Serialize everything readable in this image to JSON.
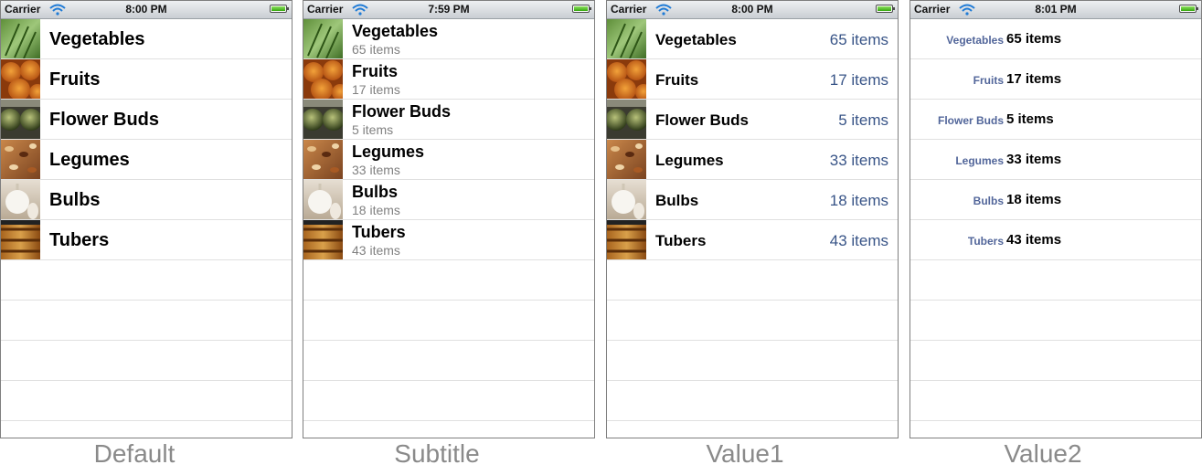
{
  "status_bar": {
    "carrier": "Carrier"
  },
  "screens": [
    {
      "caption": "Default",
      "time": "8:00 PM"
    },
    {
      "caption": "Subtitle",
      "time": "7:59 PM"
    },
    {
      "caption": "Value1",
      "time": "8:00 PM"
    },
    {
      "caption": "Value2",
      "time": "8:01 PM"
    }
  ],
  "items": [
    {
      "title": "Vegetables",
      "detail": "65 items",
      "thumb": "vegetables-photo"
    },
    {
      "title": "Fruits",
      "detail": "17 items",
      "thumb": "fruits-photo"
    },
    {
      "title": "Flower Buds",
      "detail": "5 items",
      "thumb": "flower-buds-photo"
    },
    {
      "title": "Legumes",
      "detail": "33 items",
      "thumb": "legumes-photo"
    },
    {
      "title": "Bulbs",
      "detail": "18 items",
      "thumb": "bulbs-photo"
    },
    {
      "title": "Tubers",
      "detail": "43 items",
      "thumb": "tubers-photo"
    }
  ],
  "colors": {
    "detail_blue": "#385487",
    "label_blue": "#52669a",
    "subtitle_gray": "#808080",
    "caption_gray": "#8a8a8a"
  }
}
